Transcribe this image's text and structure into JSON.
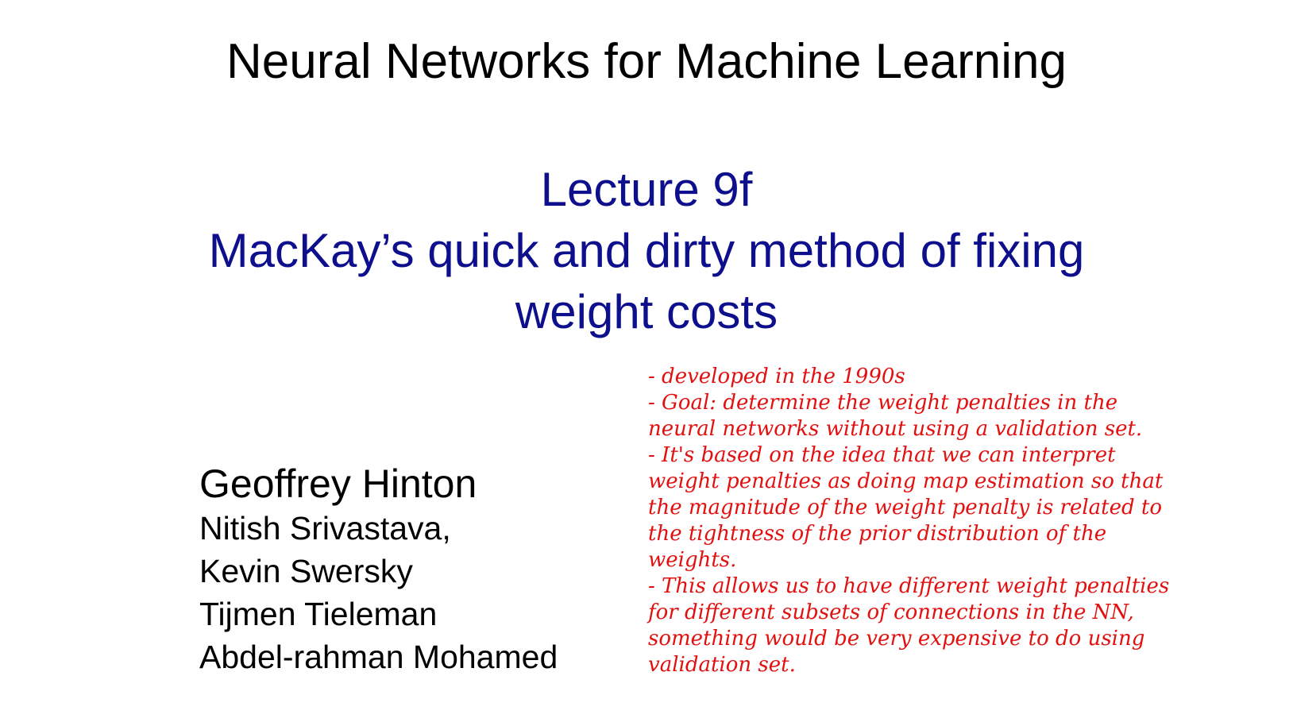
{
  "slide": {
    "course_title": "Neural Networks for Machine Learning",
    "lecture_number": "Lecture 9f",
    "lecture_title_lines": [
      "MacKay’s quick and dirty method of fixing",
      "weight costs"
    ],
    "authors": {
      "main": "Geoffrey Hinton",
      "others": [
        "Nitish Srivastava,",
        "Kevin Swersky",
        "Tijmen Tieleman",
        "Abdel-rahman Mohamed"
      ]
    },
    "handwritten_notes_lines": [
      "- developed in the 1990s",
      "- Goal: determine the weight penalties in the",
      "neural networks without using a validation set.",
      "- It's based on the idea that we can interpret",
      "weight penalties as doing map estimation so that",
      "the magnitude of the weight penalty is related to",
      "the tightness of the prior distribution of the",
      "weights.",
      "- This allows us to have different weight penalties",
      "for different subsets of connections in the NN,",
      "something would be very expensive to do using",
      "validation set."
    ]
  },
  "colors": {
    "title": "#000000",
    "lecture": "#0d0f8c",
    "notes": "#e31010",
    "background": "#ffffff"
  }
}
